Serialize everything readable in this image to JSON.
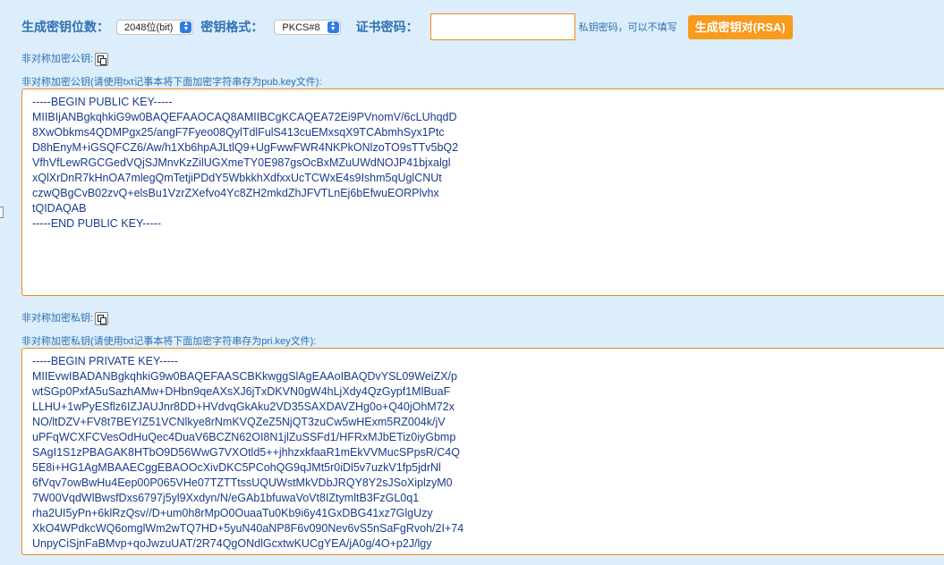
{
  "form": {
    "key_length_label": "生成密钥位数：",
    "key_length_value": "2048位(bit)",
    "key_format_label": "密钥格式：",
    "key_format_value": "PKCS#8",
    "cert_password_label": "证书密码：",
    "cert_password_value": "",
    "cert_password_hint": "私钥密码，可以不填写",
    "generate_button": "生成密钥对(RSA)"
  },
  "public_key": {
    "section_label": "非对称加密公钥:",
    "instruction": "非对称加密公钥(请使用txt记事本将下面加密字符串存为pub.key文件):",
    "lines": [
      "-----BEGIN PUBLIC KEY-----",
      "MIIBIjANBgkqhkiG9w0BAQEFAAOCAQ8AMIIBCgKCAQEA72Ei9PVnomV/6cLUhqdD",
      "8XwObkms4QDMPgx25/angF7Fyeo08QylTdlFulS413cuEMxsqX9TCAbmhSyx1Ptc",
      "D8hEnyM+iGSQFCZ6/Aw/h1Xb6hpAJLtlQ9+UgFwwFWR4NKPkONlzoTO9sTTv5bQ2",
      "VfhVfLewRGCGedVQjSJMnvKzZilUGXmeTY0E987gsOcBxMZuUWdNOJP41bjxalgl",
      "xQlXrDnR7kHnOA7mlegQmTetjiPDdY5WbkkhXdfxxUcTCWxE4s9Ishm5qUglCNUt",
      "czwQBgCvB02zvQ+elsBu1VzrZXefvo4Yc8ZH2mkdZhJFVTLnEj6bEfwuEORPlvhx",
      "tQIDAQAB",
      "-----END PUBLIC KEY-----"
    ]
  },
  "private_key": {
    "section_label": "非对称加密私钥:",
    "instruction": "非对称加密私钥(请使用txt记事本将下面加密字符串存为pri.key文件):",
    "lines": [
      "-----BEGIN PRIVATE KEY-----",
      "MIIEvwIBADANBgkqhkiG9w0BAQEFAASCBKkwggSlAgEAAoIBAQDvYSL09WeiZX/p",
      "wtSGp0PxfA5uSazhAMw+DHbn9qeAXsXJ6jTxDKVN0gW4hLjXdy4QzGypf1MlBuaF",
      "LLHU+1wPyESflz6IZJAUJnr8DD+HVdvqGkAku2VD35SAXDAVZHg0o+Q40jOhM72x",
      "NO/ltDZV+FV8t7BEYIZ51VCNlkye8rNmKVQZeZ5NjQT3zuCw5wHExm5RZ004k/jV",
      "uPFqWCXFCVesOdHuQec4DuaV6BCZN62OI8N1jlZuSSFd1/HFRxMJbETiz0iyGbmp",
      "SAgI1S1zPBAGAK8HTbO9D56WwG7VXOtld5++jhhzxkfaaR1mEkVVMucSPpsR/C4Q",
      "5E8i+HG1AgMBAAECggEBAOOcXivDKC5PCohQG9qJMt5r0iDl5v7uzkV1fp5jdrNl",
      "6fVqv7owBwHu4Eep00P065VHe07TZTTtssUQUWstMkVDbJRQY8Y2sJSoXiplzyM0",
      "7W00VqdWlBwsfDxs6797j5yl9Xxdyn/N/eGAb1bfuwaVoVt8IZtymltB3FzGL0q1",
      "rha2UI5yPn+6klRzQsv//D+um0h8rMpO0OuaaTu0Kb9i6y41GxDBG41xz7GlgUzy",
      "XkO4WPdkcWQ6omglWm2wTQ7HD+5yuN40aNP8F6v090Nev6vS5nSaFgRvoh/2I+74",
      "UnpyCiSjnFaBMvp+qoJwzuUAT/2R74QgONdlGcxtwKUCgYEA/jA0g/4O+p2J/lgy"
    ]
  }
}
